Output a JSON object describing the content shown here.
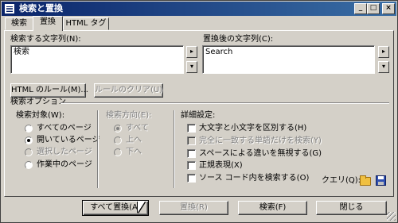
{
  "window": {
    "title": "検索と置換",
    "minimize": "_",
    "maximize": "□",
    "close": "×"
  },
  "tabs": [
    {
      "label": "検索"
    },
    {
      "label": "置換"
    },
    {
      "label": "HTML タグ"
    }
  ],
  "find": {
    "label": "検索する文字列(N):",
    "value": "検索"
  },
  "replace": {
    "label": "置換後の文字列(C):",
    "value": "Search"
  },
  "spinner": {
    "next": "▸",
    "down": "▾"
  },
  "rule_buttons": {
    "html_rules": "HTML のルール(M)...",
    "clear_rules": "ルールのクリア(U)"
  },
  "options": {
    "group_label": "検索オプション",
    "target_label": "検索対象(W):",
    "targets": [
      {
        "label": "すべてのページ",
        "checked": false,
        "disabled": false
      },
      {
        "label": "開いているページ",
        "checked": true,
        "disabled": false
      },
      {
        "label": "選択したページ",
        "checked": false,
        "disabled": true
      },
      {
        "label": "作業中のページ",
        "checked": false,
        "disabled": false
      }
    ],
    "direction_label": "検索方向(E):",
    "directions": [
      {
        "label": "すべて",
        "checked": true
      },
      {
        "label": "上へ",
        "checked": false
      },
      {
        "label": "下へ",
        "checked": false
      }
    ],
    "advanced_label": "詳細設定:",
    "advanced": [
      {
        "label": "大文字と小文字を区別する(H)",
        "disabled": false
      },
      {
        "label": "完全に一致する単語だけを検索(Y)",
        "disabled": true
      },
      {
        "label": "スペースによる違いを無視する(G)",
        "disabled": false
      },
      {
        "label": "正規表現(X)",
        "disabled": false
      },
      {
        "label": "ソース コード内を検索する(O)",
        "disabled": false
      }
    ],
    "query_label": "クエリ(Q):"
  },
  "buttons": {
    "replace_all": "すべて置換(A)",
    "replace": "置換(R)",
    "find": "検索(F)",
    "close": "閉じる"
  }
}
